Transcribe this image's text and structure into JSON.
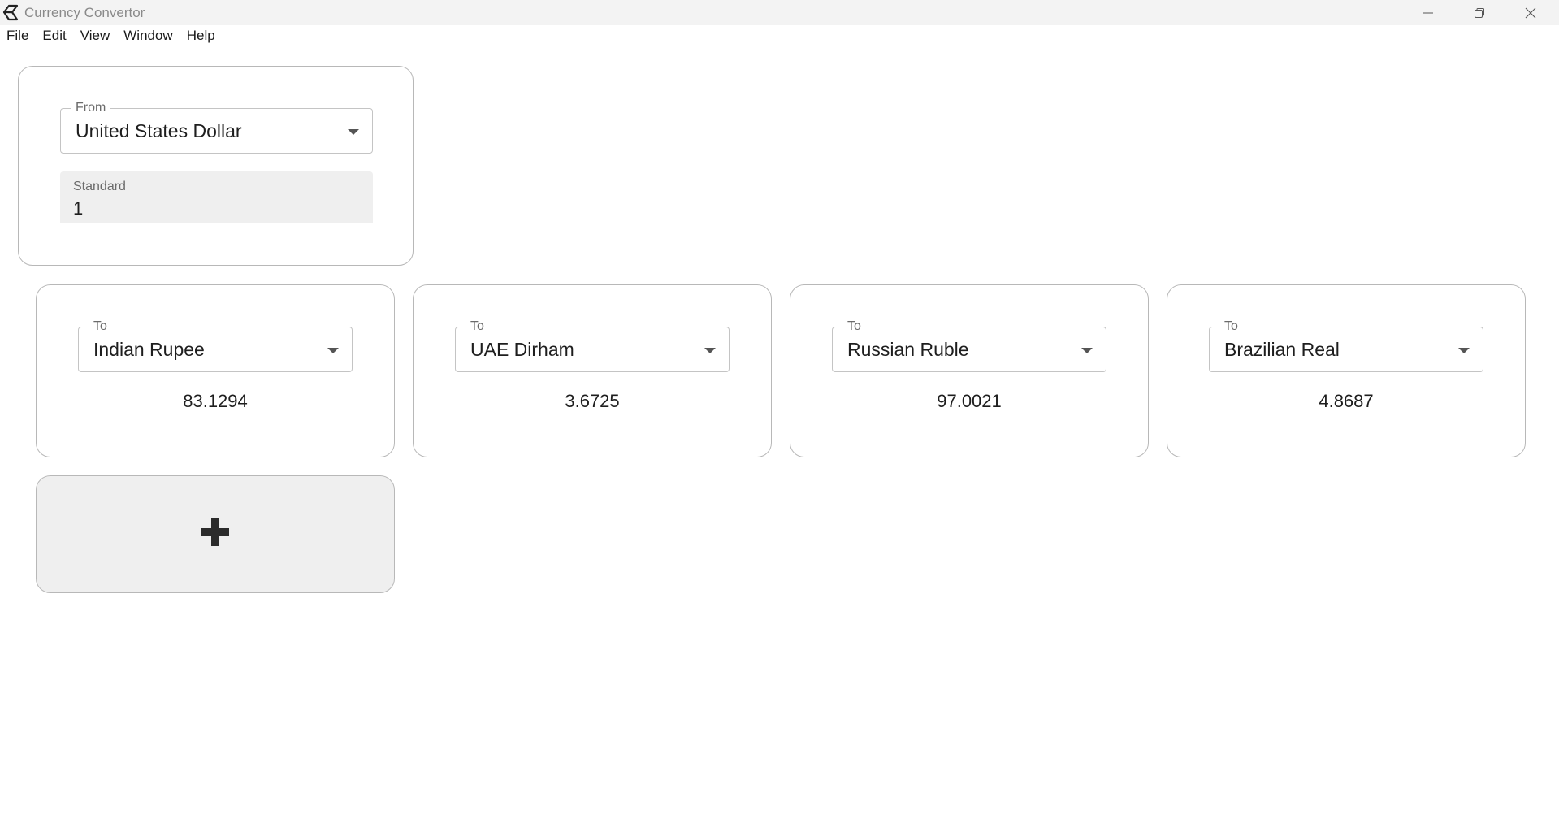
{
  "window": {
    "title": "Currency Convertor",
    "icons": {
      "app": "app-logo-icon",
      "minimize": "minimize-icon",
      "maximize": "restore-icon",
      "close": "close-icon"
    }
  },
  "menubar": {
    "items": [
      "File",
      "Edit",
      "View",
      "Window",
      "Help"
    ]
  },
  "from": {
    "label": "From",
    "selected": "United States Dollar",
    "standard_label": "Standard",
    "standard_value": "1"
  },
  "to": [
    {
      "label": "To",
      "selected": "Indian Rupee",
      "value": "83.1294"
    },
    {
      "label": "To",
      "selected": "UAE Dirham",
      "value": "3.6725"
    },
    {
      "label": "To",
      "selected": "Russian Ruble",
      "value": "97.0021"
    },
    {
      "label": "To",
      "selected": "Brazilian Real",
      "value": "4.8687"
    }
  ],
  "add_card": {
    "icon": "plus-icon"
  },
  "colors": {
    "titlebar_bg": "#f3f3f3",
    "card_border": "#b8b8b8",
    "field_bg": "#efefef"
  }
}
